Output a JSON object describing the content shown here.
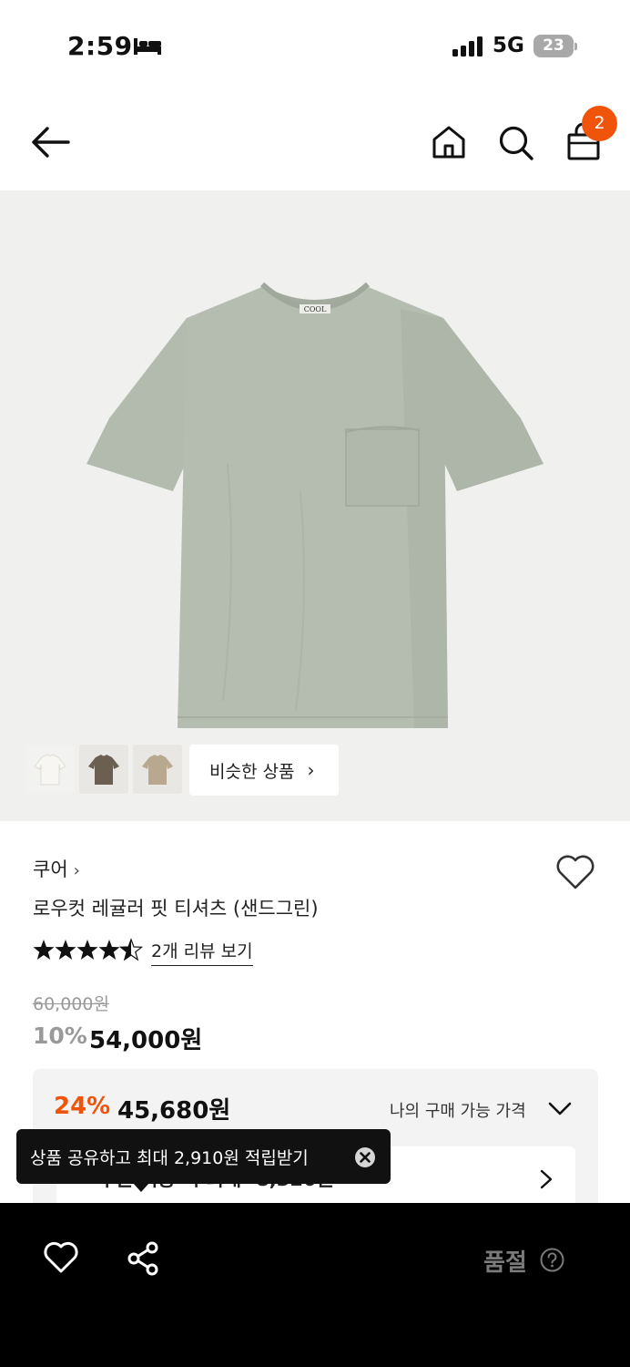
{
  "status_bar": {
    "time": "2:59",
    "network": "5G",
    "battery": "23"
  },
  "header": {
    "cart_count": "2"
  },
  "gallery": {
    "collar_label": "COOL",
    "similar_label": "비슷한 상품",
    "similar_chevron": "›"
  },
  "product": {
    "brand": "쿠어",
    "brand_arrow": "›",
    "name": "로우컷 레귤러 핏 티셔츠 (샌드그린)",
    "rating": 4.5,
    "reviews_label": "2개 리뷰 보기",
    "original_price": "60,000원",
    "discount_rate": "10%",
    "price": "54,000원"
  },
  "my_price": {
    "discount_rate": "24%",
    "price": "45,680원",
    "label": "나의 구매 가능 가격",
    "coupon_text": "쿠폰 적용 시 최대 -8,320원"
  },
  "tooltip": {
    "text": "상품 공유하고 최대 2,910원 적립받기"
  },
  "bottom_bar": {
    "status": "품절"
  },
  "colors": {
    "accent": "#f0540a",
    "tshirt": "#b5bcb0",
    "tshirt_shadow": "#a3aa9e"
  }
}
